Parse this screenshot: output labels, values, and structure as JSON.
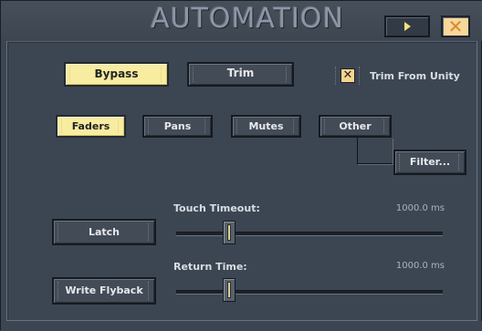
{
  "window": {
    "title": "AUTOMATION",
    "play_icon": "play-icon",
    "close_icon": "close-icon",
    "close_glyph": "✕"
  },
  "top_row": {
    "bypass_label": "Bypass",
    "bypass_on": true,
    "trim_label": "Trim",
    "trim_on": false,
    "trim_from_unity_label": "Trim From Unity",
    "trim_from_unity_checked": true,
    "check_glyph": "✕"
  },
  "filters": {
    "faders_label": "Faders",
    "faders_on": true,
    "pans_label": "Pans",
    "mutes_label": "Mutes",
    "other_label": "Other",
    "filter_button_label": "Filter..."
  },
  "latch": {
    "label": "Latch"
  },
  "touch_timeout": {
    "label": "Touch Timeout:",
    "value_text": "1000.0 ms",
    "level": 0.2
  },
  "write_flyback": {
    "label": "Write Flyback"
  },
  "return_time": {
    "label": "Return Time:",
    "value_text": "1000.0 ms",
    "level": 0.2
  },
  "colors": {
    "background": "#3c4653",
    "button_on": "#f7eca0",
    "close_button": "#f8d79a",
    "accent_orange": "#d88a31"
  }
}
